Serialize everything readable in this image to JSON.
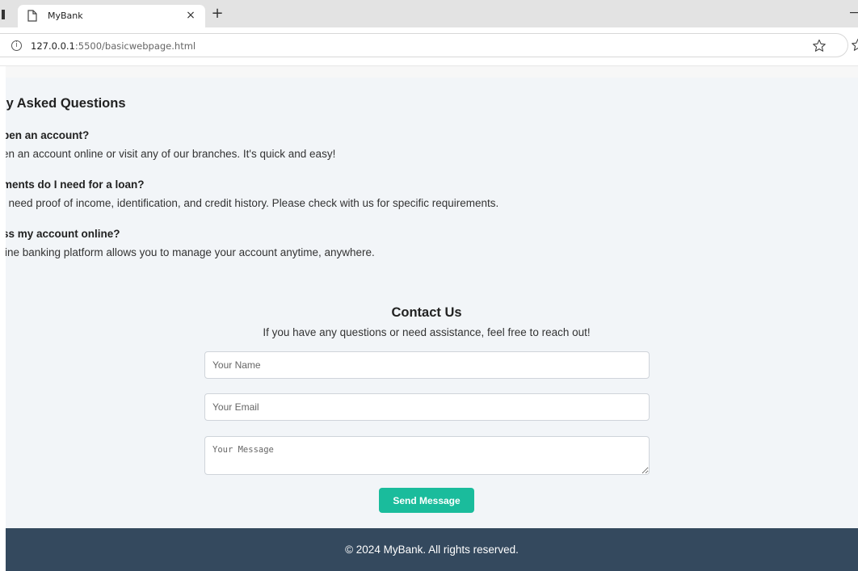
{
  "browser": {
    "tab_title": "MyBank",
    "tab_close_glyph": "×",
    "new_tab_glyph": "+",
    "url_host": "127.0.0.1",
    "url_rest": ":5500/basicwebpage.html",
    "info_glyph": "i",
    "icons": [
      "page-icon",
      "close-icon",
      "plus-icon",
      "info-icon",
      "star-icon"
    ]
  },
  "faq": {
    "title": "ly Asked Questions",
    "items": [
      {
        "question": "pen an account?",
        "answer": "en an account online or visit any of our branches. It's quick and easy!"
      },
      {
        "question": "ments do I need for a loan?",
        "answer": "/ need proof of income, identification, and credit history. Please check with us for specific requirements."
      },
      {
        "question": "ss my account online?",
        "answer": "line banking platform allows you to manage your account anytime, anywhere."
      }
    ]
  },
  "contact": {
    "title": "Contact Us",
    "subtitle": "If you have any questions or need assistance, feel free to reach out!",
    "name_placeholder": "Your Name",
    "email_placeholder": "Your Email",
    "message_placeholder": "Your Message",
    "send_label": "Send Message"
  },
  "footer": {
    "text": "© 2024 MyBank. All rights reserved."
  },
  "colors": {
    "accent": "#1abc9c",
    "footer_bg": "#34495e",
    "page_bg": "#f2f5f8"
  }
}
